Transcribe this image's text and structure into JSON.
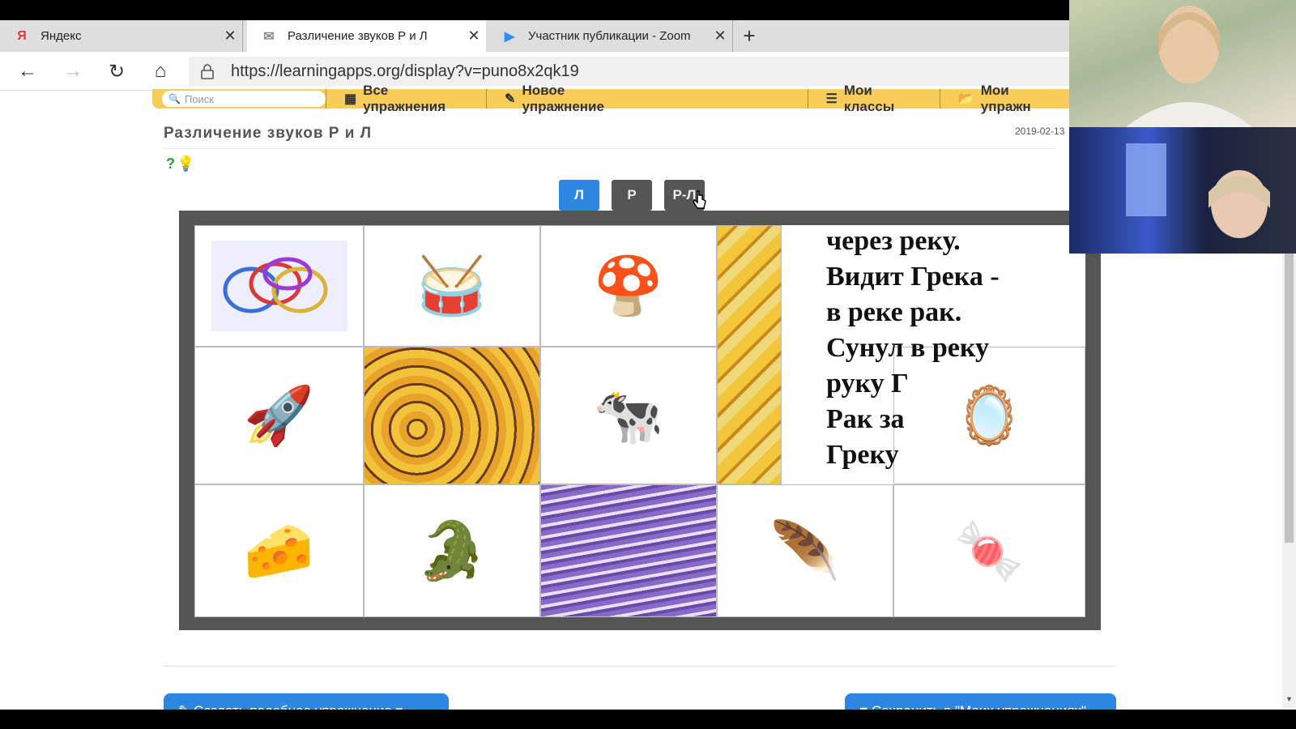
{
  "browser": {
    "tabs": [
      {
        "favicon": "Я",
        "title": "Яндекс",
        "close": "✕"
      },
      {
        "favicon": "✉",
        "title": "Различение звуков Р и Л",
        "close": "✕"
      },
      {
        "favicon": "▶",
        "title": "Участник публикации - Zoom",
        "close": "✕"
      }
    ],
    "new_tab": "+",
    "url": "https://learningapps.org/display?v=puno8x2qk19",
    "nav": {
      "back": "←",
      "forward": "→",
      "reload": "↻",
      "home": "⌂"
    }
  },
  "menu": {
    "search_placeholder": "Поиск",
    "items": [
      "Все упражнения",
      "Новое упражнение",
      "Мои классы",
      "Мои упражн"
    ]
  },
  "page": {
    "title": "Различение звуков Р и Л",
    "date": "2019-02-13",
    "hint_icons": [
      "?",
      "💡"
    ]
  },
  "filters": [
    {
      "label": "Л",
      "active": true
    },
    {
      "label": "Р",
      "active": false
    },
    {
      "label": "Р-Л",
      "active": false
    }
  ],
  "puzzle": {
    "pictures": [
      {
        "icon": "bracelets-image",
        "glyph": "◎"
      },
      {
        "icon": "drum-image",
        "glyph": "🥁"
      },
      {
        "icon": "mushroom-image",
        "glyph": "🍄"
      },
      {
        "icon": "rocket-image",
        "glyph": "🚀"
      },
      {
        "icon": "cow-image",
        "glyph": "🐄"
      },
      {
        "icon": "mirror-image",
        "glyph": "🪞"
      },
      {
        "icon": "cheese-image",
        "glyph": "🧀"
      },
      {
        "icon": "crocodile-image",
        "glyph": "🐊"
      },
      {
        "icon": "wing-image",
        "glyph": "🪶"
      },
      {
        "icon": "candy-image",
        "glyph": "🍬"
      }
    ],
    "poem_lines": [
      "через реку.",
      "Видит Грека -",
      " в реке рак.",
      "Сунул в реку",
      "руку Г",
      "Рак за",
      "Греку"
    ]
  },
  "footer": {
    "create_button": "Создать подобное упражнение",
    "save_button": "Сохранить в \"Моих упражнениях\""
  }
}
